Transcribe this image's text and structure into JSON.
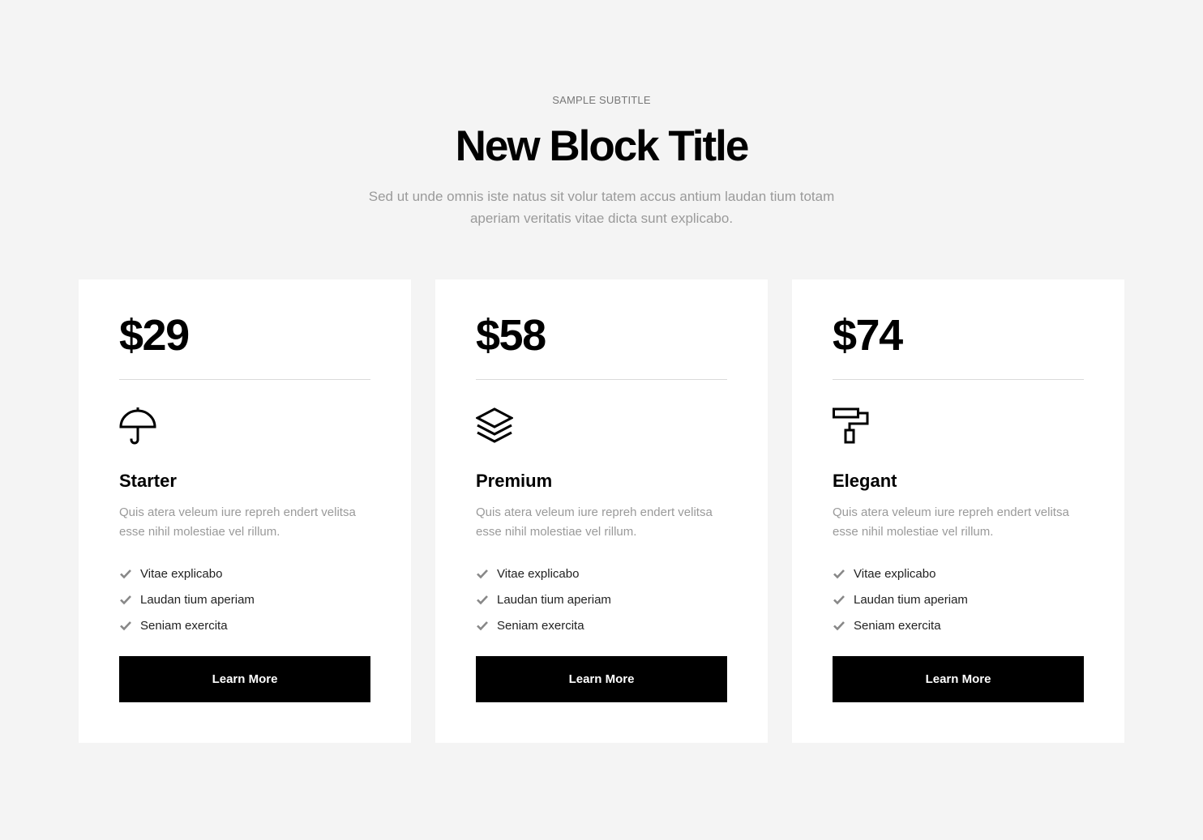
{
  "header": {
    "subtitle": "SAMPLE SUBTITLE",
    "title": "New Block Title",
    "lead": "Sed ut unde omnis iste natus sit volur tatem accus antium laudan tium totam aperiam veritatis vitae dicta sunt explicabo."
  },
  "plans": [
    {
      "price": "$29",
      "icon": "umbrella-icon",
      "name": "Starter",
      "description": "Quis atera veleum iure repreh endert velitsa esse nihil molestiae vel rillum.",
      "features": [
        "Vitae explicabo",
        "Laudan tium aperiam",
        "Seniam exercita"
      ],
      "button_label": "Learn More"
    },
    {
      "price": "$58",
      "icon": "layers-icon",
      "name": "Premium",
      "description": "Quis atera veleum iure repreh endert velitsa esse nihil molestiae vel rillum.",
      "features": [
        "Vitae explicabo",
        "Laudan tium aperiam",
        "Seniam exercita"
      ],
      "button_label": "Learn More"
    },
    {
      "price": "$74",
      "icon": "paint-roller-icon",
      "name": "Elegant",
      "description": "Quis atera veleum iure repreh endert velitsa esse nihil molestiae vel rillum.",
      "features": [
        "Vitae explicabo",
        "Laudan tium aperiam",
        "Seniam exercita"
      ],
      "button_label": "Learn More"
    }
  ],
  "colors": {
    "background": "#f4f4f4",
    "card": "#ffffff",
    "button": "#000000",
    "muted_text": "#9a9a9a",
    "check": "#888888"
  }
}
